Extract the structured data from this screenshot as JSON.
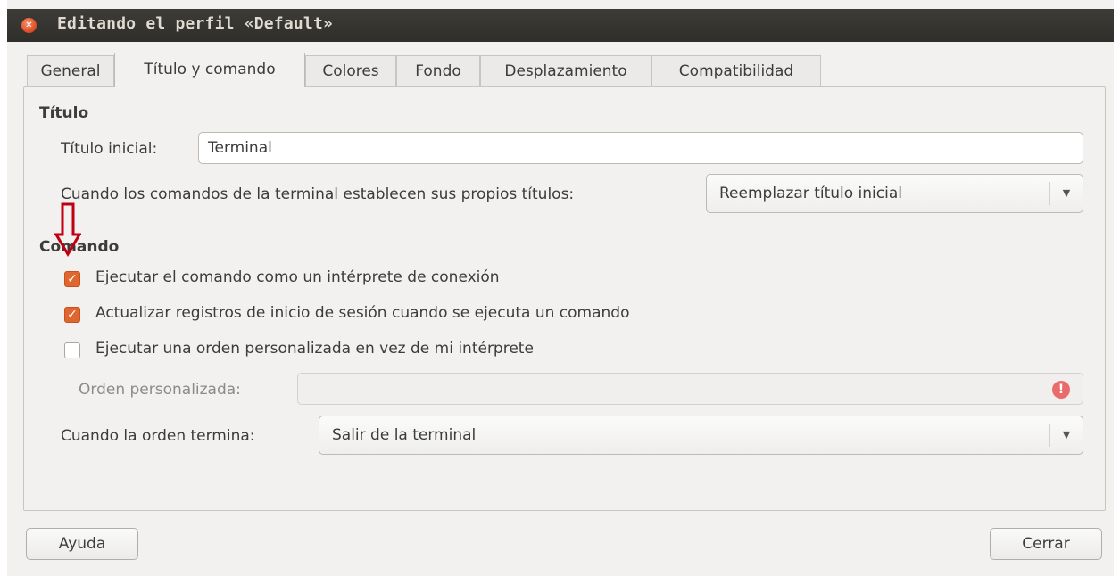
{
  "window": {
    "title": "Editando el perfil «Default»"
  },
  "tabs": [
    "General",
    "Título y comando",
    "Colores",
    "Fondo",
    "Desplazamiento",
    "Compatibilidad"
  ],
  "active_tab": "Título y comando",
  "titulo_section": {
    "heading": "Título",
    "initial_title_label": "Título inicial:",
    "initial_title_value": "Terminal",
    "dynamic_label": "Cuando los comandos de la terminal establecen sus propios títulos:",
    "dynamic_value": "Reemplazar título inicial"
  },
  "comando_section": {
    "heading": "Comando",
    "login_shell": {
      "label": "Ejecutar el comando como un intérprete de conexión",
      "checked": true
    },
    "update_records": {
      "label": "Actualizar registros de inicio de sesión cuando se ejecuta un comando",
      "checked": true
    },
    "custom_command": {
      "label": "Ejecutar una orden personalizada en vez de mi intérprete",
      "checked": false
    },
    "custom_order_label": "Orden personalizada:",
    "custom_order_value": "",
    "exit_label": "Cuando la orden termina:",
    "exit_value": "Salir de la terminal"
  },
  "footer": {
    "help": "Ayuda",
    "close": "Cerrar"
  },
  "colors": {
    "accent": "#e0662f",
    "annotation_arrow": "#c0000f",
    "titlebar": "#3d3c37"
  }
}
